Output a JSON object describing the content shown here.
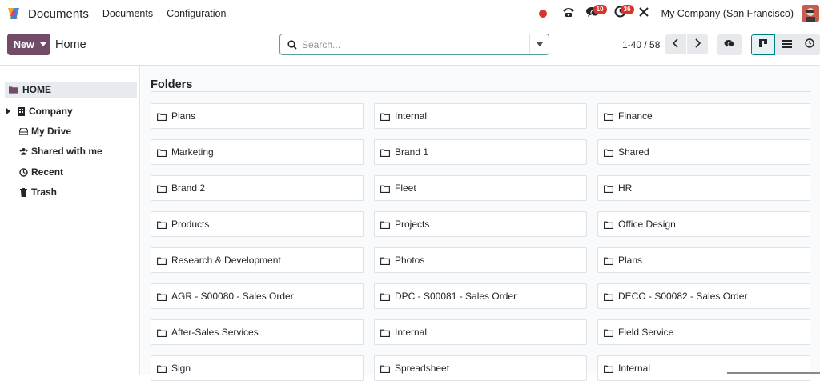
{
  "app": {
    "name": "Documents"
  },
  "nav_menu": [
    "Documents",
    "Configuration"
  ],
  "systray": {
    "messages_count": "10",
    "activities_count": "36",
    "company": "My Company (San Francisco)"
  },
  "control_panel": {
    "new_label": "New",
    "breadcrumb": "Home",
    "search_placeholder": "Search...",
    "pager": "1-40 / 58"
  },
  "sidebar": {
    "home": "HOME",
    "items": [
      {
        "label": "Company",
        "icon": "building-icon",
        "expandable": true
      },
      {
        "label": "My Drive",
        "icon": "hdd-icon"
      },
      {
        "label": "Shared with me",
        "icon": "users-icon"
      },
      {
        "label": "Recent",
        "icon": "clock-icon"
      },
      {
        "label": "Trash",
        "icon": "trash-icon"
      }
    ]
  },
  "main": {
    "section_title": "Folders",
    "folders": [
      "Plans",
      "Internal",
      "Finance",
      "Marketing",
      "Brand 1",
      "Shared",
      "Brand 2",
      "Fleet",
      "HR",
      "Products",
      "Projects",
      "Office Design",
      "Research & Development",
      "Photos",
      "Plans",
      "AGR - S00080 - Sales Order",
      "DPC - S00081 - Sales Order",
      "DECO - S00082 - Sales Order",
      "After-Sales Services",
      "Internal",
      "Field Service",
      "Sign",
      "Spreadsheet",
      "Internal"
    ]
  },
  "colors": {
    "brand": "#714b67",
    "accent": "#017e84",
    "badge": "#d9342b"
  }
}
